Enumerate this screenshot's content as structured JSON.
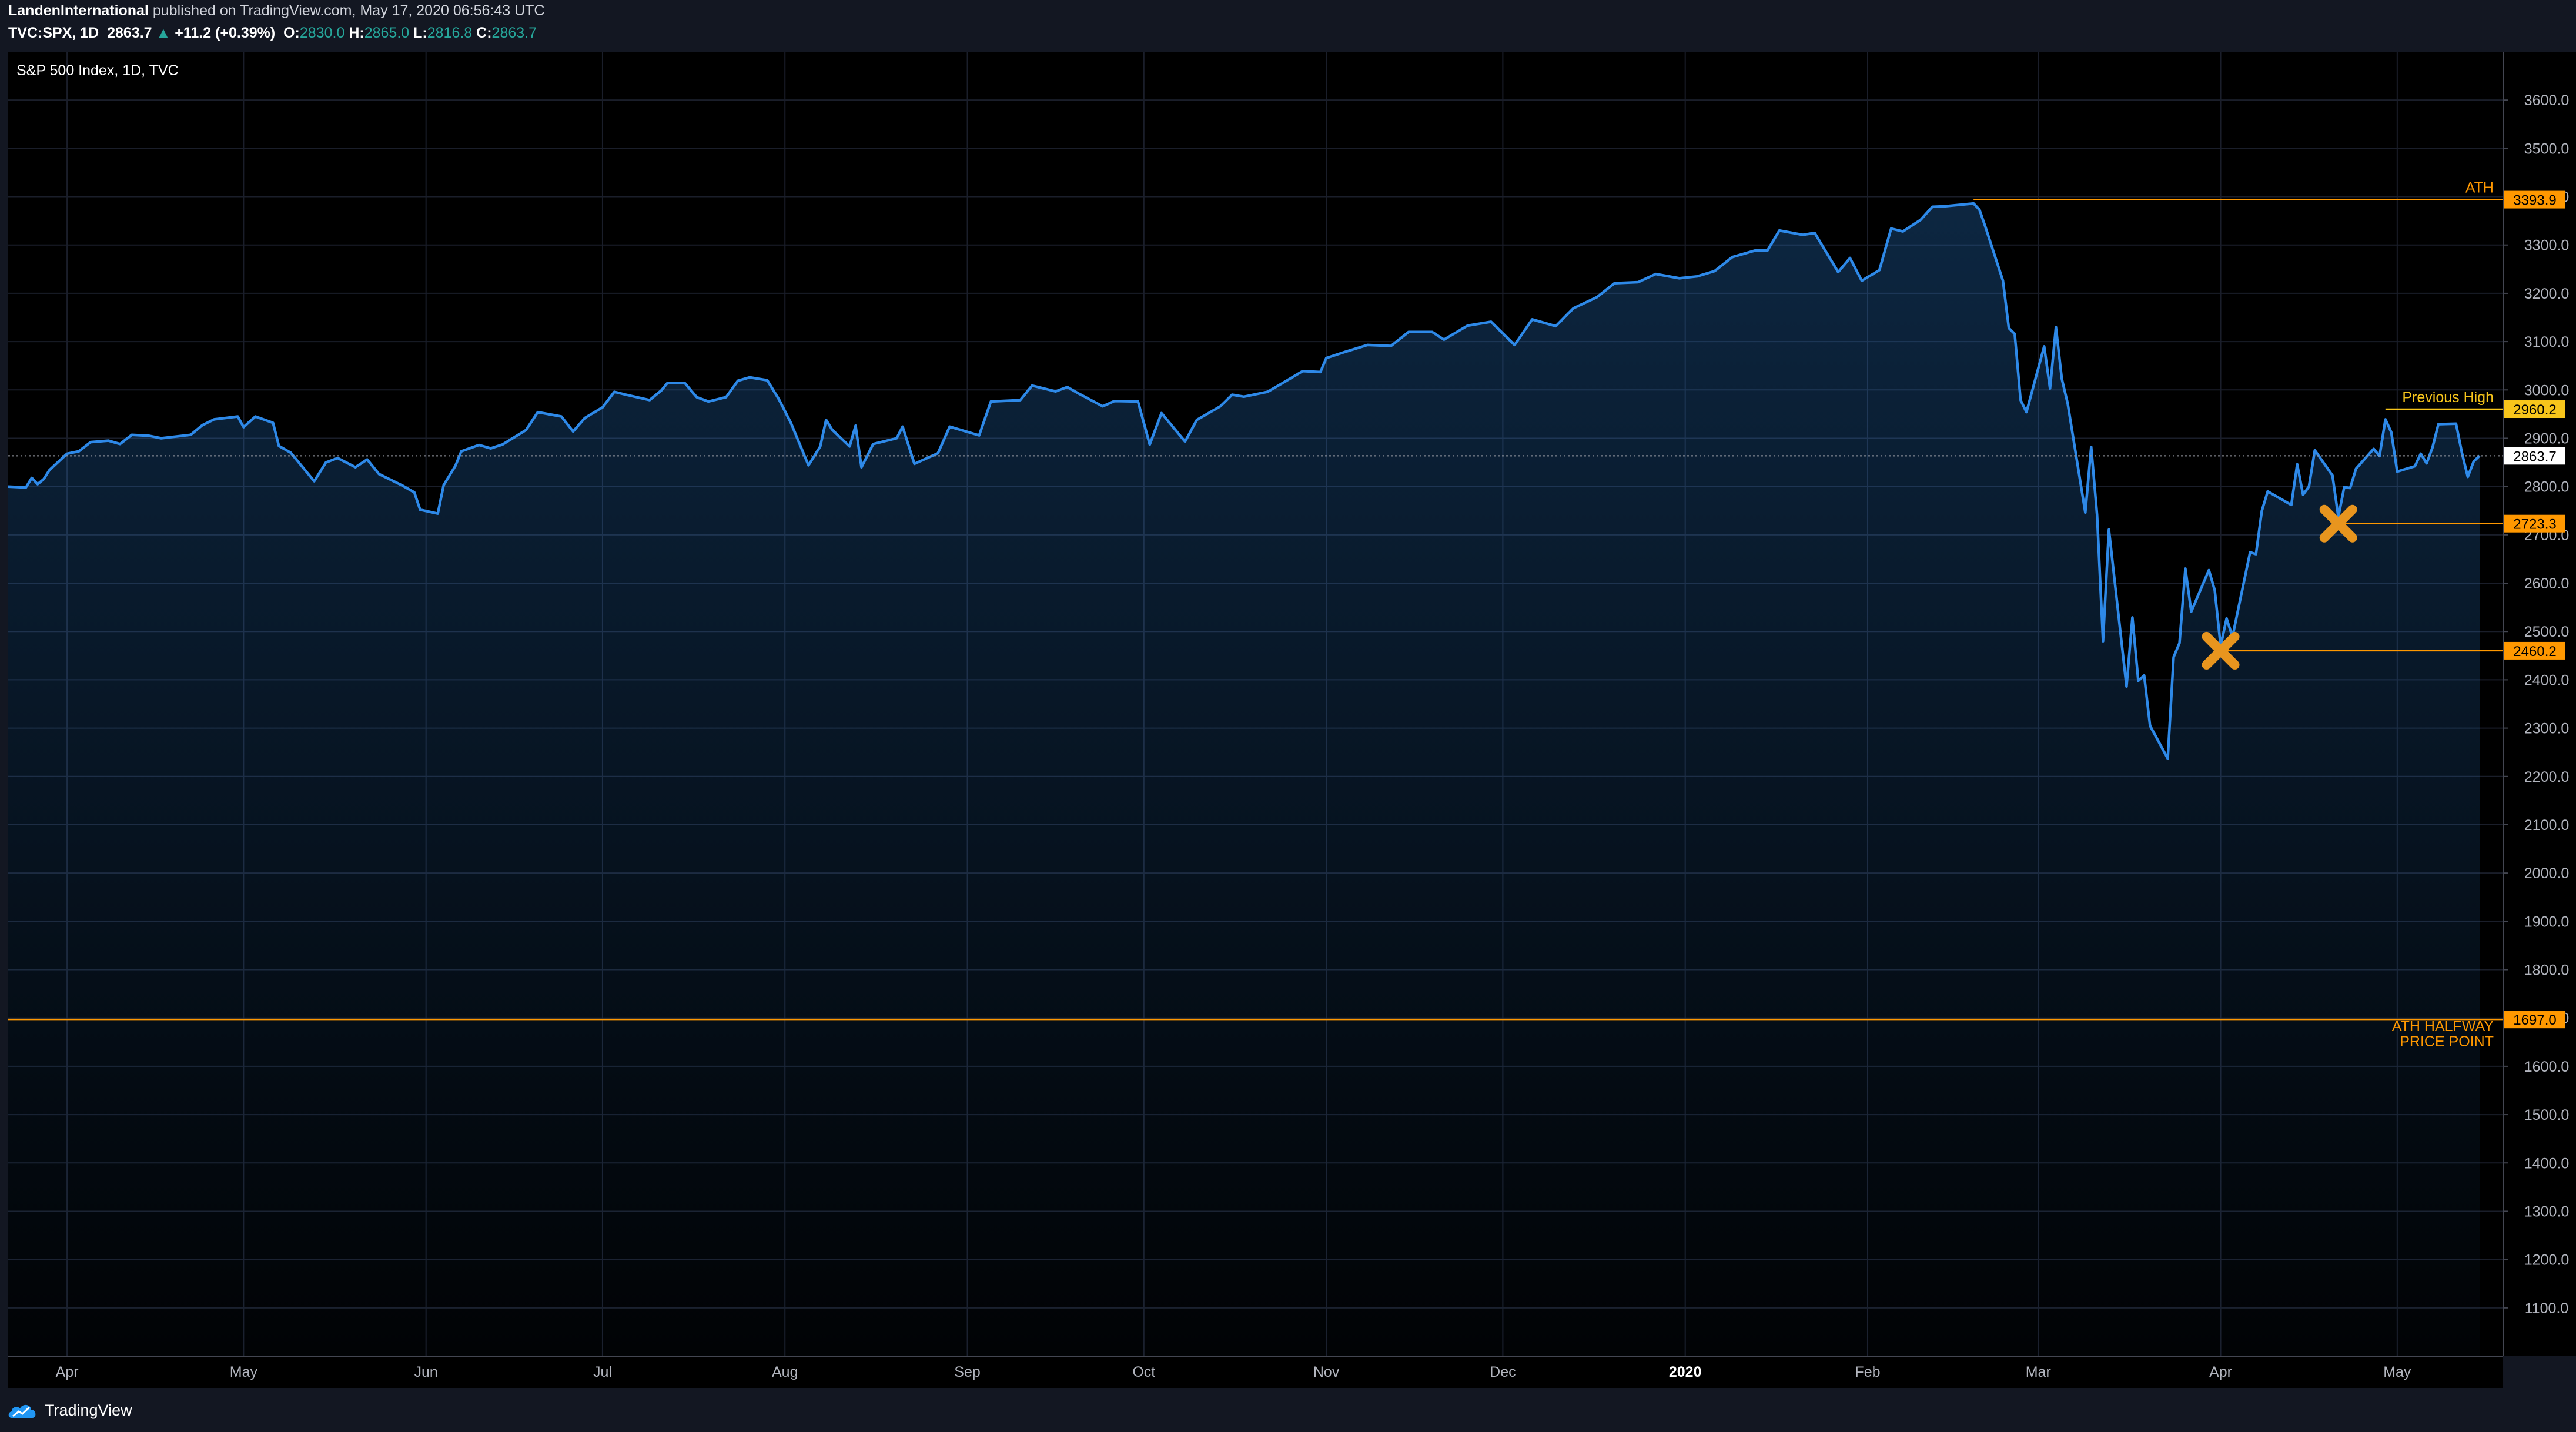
{
  "header": {
    "publisher": "LandenInternational",
    "published_text": "published on TradingView.com, May 17, 2020 06:56:43 UTC",
    "symbol": "TVC:SPX, 1D",
    "last": "2863.7",
    "arrow": "▲",
    "change": "+11.2 (+0.39%)",
    "o_label": "O:",
    "o_value": "2830.0",
    "h_label": "H:",
    "h_value": "2865.0",
    "l_label": "L:",
    "l_value": "2816.8",
    "c_label": "C:",
    "c_value": "2863.7"
  },
  "footer": {
    "brand": "TradingView"
  },
  "colors": {
    "background": "#000000",
    "panel": "#131722",
    "line": "#2e89e8",
    "orange": "#ff9800",
    "yellow": "#f7c51b",
    "marker": "#e8951e",
    "grid": "#1a1e2a",
    "axis_text": "#b2b5be"
  },
  "chart_data": {
    "type": "area",
    "title": "S&P 500 Index, 1D, TVC",
    "ylim": [
      1000,
      3700
    ],
    "y_ticks": [
      1100,
      1200,
      1300,
      1400,
      1500,
      1600,
      1700,
      1800,
      1900,
      2000,
      2100,
      2200,
      2300,
      2400,
      2500,
      2600,
      2700,
      2800,
      2900,
      3000,
      3100,
      3200,
      3300,
      3400,
      3500,
      3600
    ],
    "x_range": [
      "2019-03-22",
      "2020-05-19"
    ],
    "x_ticks": [
      {
        "label": "Apr",
        "date": "2019-04-01"
      },
      {
        "label": "May",
        "date": "2019-05-01"
      },
      {
        "label": "Jun",
        "date": "2019-06-01"
      },
      {
        "label": "Jul",
        "date": "2019-07-01"
      },
      {
        "label": "Aug",
        "date": "2019-08-01"
      },
      {
        "label": "Sep",
        "date": "2019-09-01"
      },
      {
        "label": "Oct",
        "date": "2019-10-01"
      },
      {
        "label": "Nov",
        "date": "2019-11-01"
      },
      {
        "label": "Dec",
        "date": "2019-12-01"
      },
      {
        "label": "2020",
        "date": "2020-01-01",
        "bold": true
      },
      {
        "label": "Feb",
        "date": "2020-02-01"
      },
      {
        "label": "Mar",
        "date": "2020-03-01"
      },
      {
        "label": "Apr",
        "date": "2020-04-01"
      },
      {
        "label": "May",
        "date": "2020-05-01"
      }
    ],
    "series": [
      {
        "points": [
          [
            "2019-03-22",
            2800
          ],
          [
            "2019-03-25",
            2798
          ],
          [
            "2019-03-26",
            2818
          ],
          [
            "2019-03-27",
            2805
          ],
          [
            "2019-03-28",
            2815
          ],
          [
            "2019-03-29",
            2834
          ],
          [
            "2019-04-01",
            2868
          ],
          [
            "2019-04-03",
            2873
          ],
          [
            "2019-04-05",
            2892
          ],
          [
            "2019-04-08",
            2895
          ],
          [
            "2019-04-10",
            2888
          ],
          [
            "2019-04-12",
            2907
          ],
          [
            "2019-04-15",
            2905
          ],
          [
            "2019-04-17",
            2900
          ],
          [
            "2019-04-22",
            2907
          ],
          [
            "2019-04-24",
            2927
          ],
          [
            "2019-04-26",
            2939
          ],
          [
            "2019-04-30",
            2945
          ],
          [
            "2019-05-01",
            2923
          ],
          [
            "2019-05-03",
            2945
          ],
          [
            "2019-05-06",
            2932
          ],
          [
            "2019-05-07",
            2884
          ],
          [
            "2019-05-09",
            2870
          ],
          [
            "2019-05-13",
            2811
          ],
          [
            "2019-05-15",
            2850
          ],
          [
            "2019-05-17",
            2859
          ],
          [
            "2019-05-20",
            2840
          ],
          [
            "2019-05-22",
            2856
          ],
          [
            "2019-05-24",
            2826
          ],
          [
            "2019-05-28",
            2802
          ],
          [
            "2019-05-30",
            2788
          ],
          [
            "2019-05-31",
            2752
          ],
          [
            "2019-06-03",
            2744
          ],
          [
            "2019-06-04",
            2803
          ],
          [
            "2019-06-06",
            2843
          ],
          [
            "2019-06-07",
            2873
          ],
          [
            "2019-06-10",
            2886
          ],
          [
            "2019-06-12",
            2879
          ],
          [
            "2019-06-14",
            2887
          ],
          [
            "2019-06-18",
            2917
          ],
          [
            "2019-06-20",
            2954
          ],
          [
            "2019-06-24",
            2945
          ],
          [
            "2019-06-26",
            2914
          ],
          [
            "2019-06-28",
            2942
          ],
          [
            "2019-07-01",
            2964
          ],
          [
            "2019-07-03",
            2996
          ],
          [
            "2019-07-05",
            2990
          ],
          [
            "2019-07-09",
            2979
          ],
          [
            "2019-07-11",
            2999
          ],
          [
            "2019-07-12",
            3014
          ],
          [
            "2019-07-15",
            3014
          ],
          [
            "2019-07-17",
            2985
          ],
          [
            "2019-07-19",
            2976
          ],
          [
            "2019-07-22",
            2985
          ],
          [
            "2019-07-24",
            3019
          ],
          [
            "2019-07-26",
            3026
          ],
          [
            "2019-07-29",
            3020
          ],
          [
            "2019-07-31",
            2980
          ],
          [
            "2019-08-02",
            2932
          ],
          [
            "2019-08-05",
            2844
          ],
          [
            "2019-08-07",
            2883
          ],
          [
            "2019-08-08",
            2938
          ],
          [
            "2019-08-09",
            2918
          ],
          [
            "2019-08-12",
            2883
          ],
          [
            "2019-08-13",
            2926
          ],
          [
            "2019-08-14",
            2840
          ],
          [
            "2019-08-16",
            2888
          ],
          [
            "2019-08-20",
            2900
          ],
          [
            "2019-08-21",
            2924
          ],
          [
            "2019-08-23",
            2847
          ],
          [
            "2019-08-27",
            2869
          ],
          [
            "2019-08-29",
            2924
          ],
          [
            "2019-09-03",
            2906
          ],
          [
            "2019-09-05",
            2976
          ],
          [
            "2019-09-10",
            2979
          ],
          [
            "2019-09-12",
            3009
          ],
          [
            "2019-09-16",
            2997
          ],
          [
            "2019-09-18",
            3006
          ],
          [
            "2019-09-20",
            2992
          ],
          [
            "2019-09-24",
            2966
          ],
          [
            "2019-09-26",
            2977
          ],
          [
            "2019-09-30",
            2976
          ],
          [
            "2019-10-02",
            2887
          ],
          [
            "2019-10-04",
            2952
          ],
          [
            "2019-10-08",
            2893
          ],
          [
            "2019-10-10",
            2938
          ],
          [
            "2019-10-14",
            2966
          ],
          [
            "2019-10-16",
            2990
          ],
          [
            "2019-10-18",
            2986
          ],
          [
            "2019-10-22",
            2996
          ],
          [
            "2019-10-24",
            3010
          ],
          [
            "2019-10-28",
            3039
          ],
          [
            "2019-10-31",
            3037
          ],
          [
            "2019-11-01",
            3066
          ],
          [
            "2019-11-04",
            3078
          ],
          [
            "2019-11-08",
            3093
          ],
          [
            "2019-11-12",
            3091
          ],
          [
            "2019-11-15",
            3120
          ],
          [
            "2019-11-19",
            3120
          ],
          [
            "2019-11-21",
            3104
          ],
          [
            "2019-11-25",
            3133
          ],
          [
            "2019-11-29",
            3141
          ],
          [
            "2019-12-03",
            3093
          ],
          [
            "2019-12-06",
            3146
          ],
          [
            "2019-12-10",
            3132
          ],
          [
            "2019-12-13",
            3169
          ],
          [
            "2019-12-17",
            3192
          ],
          [
            "2019-12-20",
            3221
          ],
          [
            "2019-12-24",
            3223
          ],
          [
            "2019-12-27",
            3240
          ],
          [
            "2019-12-31",
            3231
          ],
          [
            "2020-01-03",
            3235
          ],
          [
            "2020-01-06",
            3246
          ],
          [
            "2020-01-09",
            3275
          ],
          [
            "2020-01-13",
            3289
          ],
          [
            "2020-01-15",
            3289
          ],
          [
            "2020-01-17",
            3330
          ],
          [
            "2020-01-21",
            3321
          ],
          [
            "2020-01-23",
            3325
          ],
          [
            "2020-01-27",
            3244
          ],
          [
            "2020-01-29",
            3273
          ],
          [
            "2020-01-31",
            3226
          ],
          [
            "2020-02-03",
            3248
          ],
          [
            "2020-02-05",
            3334
          ],
          [
            "2020-02-07",
            3328
          ],
          [
            "2020-02-10",
            3352
          ],
          [
            "2020-02-12",
            3379
          ],
          [
            "2020-02-14",
            3380
          ],
          [
            "2020-02-19",
            3386
          ],
          [
            "2020-02-20",
            3373
          ],
          [
            "2020-02-21",
            3338
          ],
          [
            "2020-02-24",
            3226
          ],
          [
            "2020-02-25",
            3128
          ],
          [
            "2020-02-26",
            3116
          ],
          [
            "2020-02-27",
            2979
          ],
          [
            "2020-02-28",
            2954
          ],
          [
            "2020-03-02",
            3090
          ],
          [
            "2020-03-03",
            3003
          ],
          [
            "2020-03-04",
            3130
          ],
          [
            "2020-03-05",
            3023
          ],
          [
            "2020-03-06",
            2972
          ],
          [
            "2020-03-09",
            2746
          ],
          [
            "2020-03-10",
            2882
          ],
          [
            "2020-03-11",
            2741
          ],
          [
            "2020-03-12",
            2480
          ],
          [
            "2020-03-13",
            2711
          ],
          [
            "2020-03-16",
            2386
          ],
          [
            "2020-03-17",
            2529
          ],
          [
            "2020-03-18",
            2398
          ],
          [
            "2020-03-19",
            2409
          ],
          [
            "2020-03-20",
            2305
          ],
          [
            "2020-03-23",
            2237
          ],
          [
            "2020-03-24",
            2447
          ],
          [
            "2020-03-25",
            2476
          ],
          [
            "2020-03-26",
            2630
          ],
          [
            "2020-03-27",
            2541
          ],
          [
            "2020-03-30",
            2627
          ],
          [
            "2020-03-31",
            2585
          ],
          [
            "2020-04-01",
            2470
          ],
          [
            "2020-04-02",
            2527
          ],
          [
            "2020-04-03",
            2489
          ],
          [
            "2020-04-06",
            2664
          ],
          [
            "2020-04-07",
            2660
          ],
          [
            "2020-04-08",
            2750
          ],
          [
            "2020-04-09",
            2790
          ],
          [
            "2020-04-13",
            2762
          ],
          [
            "2020-04-14",
            2846
          ],
          [
            "2020-04-15",
            2783
          ],
          [
            "2020-04-16",
            2800
          ],
          [
            "2020-04-17",
            2875
          ],
          [
            "2020-04-20",
            2823
          ],
          [
            "2020-04-21",
            2737
          ],
          [
            "2020-04-22",
            2799
          ],
          [
            "2020-04-23",
            2797
          ],
          [
            "2020-04-24",
            2837
          ],
          [
            "2020-04-27",
            2878
          ],
          [
            "2020-04-28",
            2863
          ],
          [
            "2020-04-29",
            2939
          ],
          [
            "2020-04-30",
            2912
          ],
          [
            "2020-05-01",
            2831
          ],
          [
            "2020-05-04",
            2842
          ],
          [
            "2020-05-05",
            2868
          ],
          [
            "2020-05-06",
            2848
          ],
          [
            "2020-05-07",
            2881
          ],
          [
            "2020-05-08",
            2929
          ],
          [
            "2020-05-11",
            2930
          ],
          [
            "2020-05-12",
            2870
          ],
          [
            "2020-05-13",
            2820
          ],
          [
            "2020-05-14",
            2852
          ],
          [
            "2020-05-15",
            2863.7
          ]
        ]
      }
    ],
    "last_price": {
      "value": 2863.7,
      "label": "2863.7"
    },
    "levels": [
      {
        "name": "ath",
        "value": 3393.9,
        "label": "3393.9",
        "text": "ATH",
        "color": "#ff9800",
        "from": "2020-02-19",
        "text_color": "#ff9800"
      },
      {
        "name": "previous-high",
        "value": 2960.2,
        "label": "2960.2",
        "text": "Previous High",
        "color": "#f7c51b",
        "from": "2020-04-29",
        "text_color": "#f7c51b"
      },
      {
        "name": "level-2723",
        "value": 2723.3,
        "label": "2723.3",
        "text": "",
        "color": "#ff9800",
        "from": "2020-04-21",
        "text_color": "#ff9800"
      },
      {
        "name": "level-2460",
        "value": 2460.2,
        "label": "2460.2",
        "text": "",
        "color": "#ff9800",
        "from": "2020-04-01",
        "text_color": "#ff9800"
      },
      {
        "name": "ath-halfway",
        "value": 1697.0,
        "label": "1697.0",
        "text": "ATH HALFWAY",
        "text2": "PRICE POINT",
        "color": "#ff9800",
        "from": "2019-03-22",
        "text_color": "#ff9800"
      }
    ],
    "markers": [
      {
        "name": "x-marker-april-low",
        "date": "2020-04-01",
        "value": 2460.2
      },
      {
        "name": "x-marker-april-retest",
        "date": "2020-04-21",
        "value": 2723.3
      }
    ]
  }
}
